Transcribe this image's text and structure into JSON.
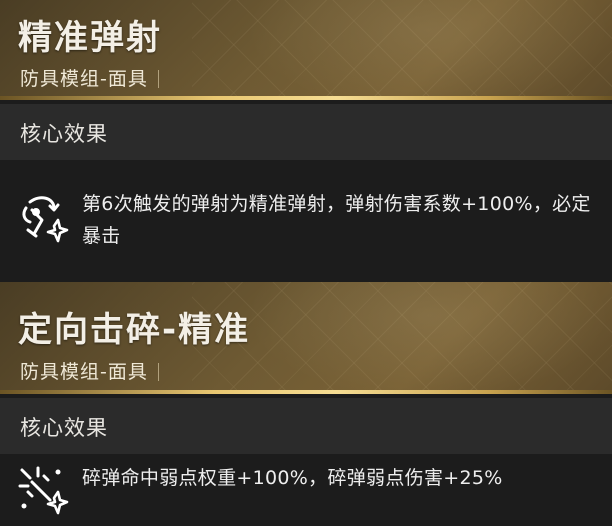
{
  "modules": [
    {
      "title": "精准弹射",
      "subtitle": "防具模组-面具",
      "section_label": "核心效果",
      "effect_icon": "ricochet-icon",
      "effect_text": "第6次触发的弹射为精准弹射，弹射伤害系数+100%，必定暴击"
    },
    {
      "title": "定向击碎-精准",
      "subtitle": "防具模组-面具",
      "section_label": "核心效果",
      "effect_icon": "shatter-icon",
      "effect_text": "碎弹命中弱点权重+100%，碎弹弱点伤害+25%"
    }
  ],
  "colors": {
    "header_gold": "#7a6236",
    "accent_line": "#e9c771",
    "section_bar": "#2b2b2b",
    "panel_bg": "#1c1c1c",
    "text": "#eeeeee"
  }
}
